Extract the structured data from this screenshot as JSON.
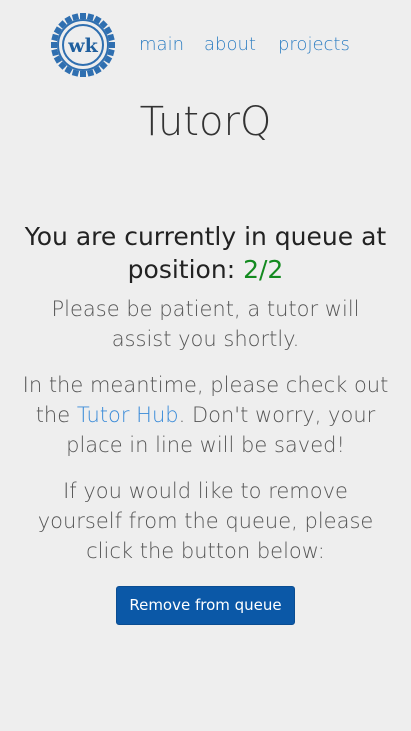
{
  "logo": {
    "text": "wk"
  },
  "nav": {
    "items": [
      {
        "label": "main"
      },
      {
        "label": "about"
      },
      {
        "label": "projects"
      }
    ]
  },
  "page": {
    "title": "TutorQ"
  },
  "queue": {
    "heading_text": "You are currently in queue at position:",
    "position": "2/2",
    "patience_text": "Please be patient, a tutor will assist you shortly.",
    "meantime_before": "In the meantime, please check out the ",
    "meantime_link": "Tutor Hub",
    "meantime_after": ". Don't worry, your place in line will be saved!",
    "remove_text": "If you would like to remove yourself from the queue, please click the button below:",
    "remove_button": "Remove from queue"
  },
  "colors": {
    "background": "#eeeeee",
    "link": "#2f7fc3",
    "position": "#138a1f",
    "button": "#0b58a7"
  }
}
